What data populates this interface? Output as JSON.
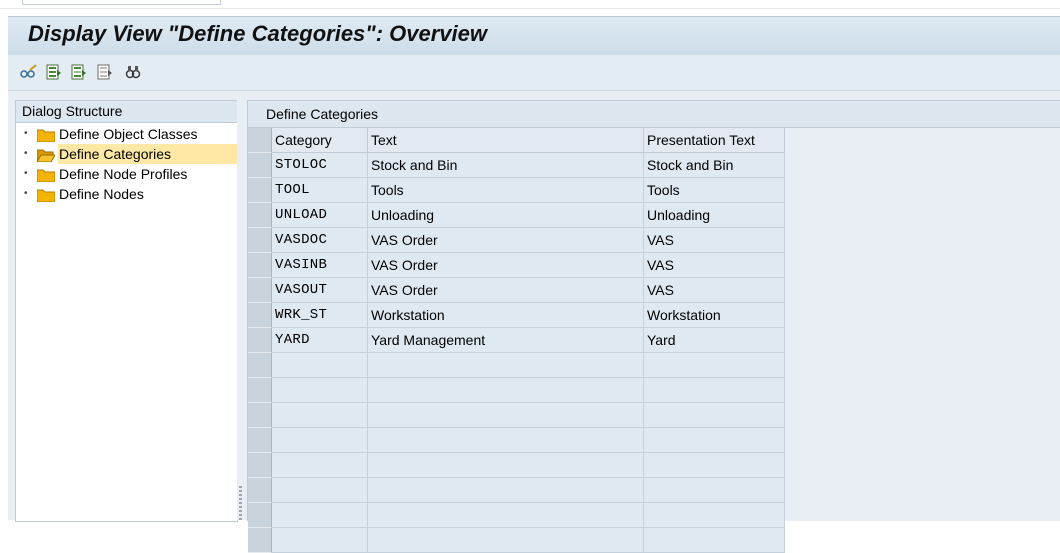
{
  "window": {
    "title": "Display View \"Define Categories\": Overview"
  },
  "toolbar": {
    "buttons": [
      {
        "icon": "change-display-icon"
      },
      {
        "icon": "select-all-icon"
      },
      {
        "icon": "select-block-icon"
      },
      {
        "icon": "deselect-all-icon"
      },
      {
        "icon": "find-icon"
      }
    ]
  },
  "dialog_structure": {
    "header": "Dialog Structure",
    "items": [
      {
        "label": "Define Object Classes",
        "selected": false
      },
      {
        "label": "Define Categories",
        "selected": true
      },
      {
        "label": "Define Node Profiles",
        "selected": false
      },
      {
        "label": "Define Nodes",
        "selected": false
      }
    ]
  },
  "table": {
    "caption": "Define Categories",
    "columns": [
      "Category",
      "Text",
      "Presentation Text"
    ],
    "rows": [
      [
        "STOLOC",
        "Stock and Bin",
        "Stock and Bin"
      ],
      [
        "TOOL",
        "Tools",
        "Tools"
      ],
      [
        "UNLOAD",
        "Unloading",
        "Unloading"
      ],
      [
        "VASDOC",
        "VAS Order",
        "VAS"
      ],
      [
        "VASINB",
        "VAS Order",
        "VAS"
      ],
      [
        "VASOUT",
        "VAS Order",
        "VAS"
      ],
      [
        "WRK_ST",
        "Workstation",
        "Workstation"
      ],
      [
        "YARD",
        "Yard Management",
        "Yard"
      ]
    ]
  },
  "colors": {
    "title_bg": "#cddde9",
    "selected_item_bg": "#fde9a5",
    "cell_bg": "#dfe9f2"
  }
}
